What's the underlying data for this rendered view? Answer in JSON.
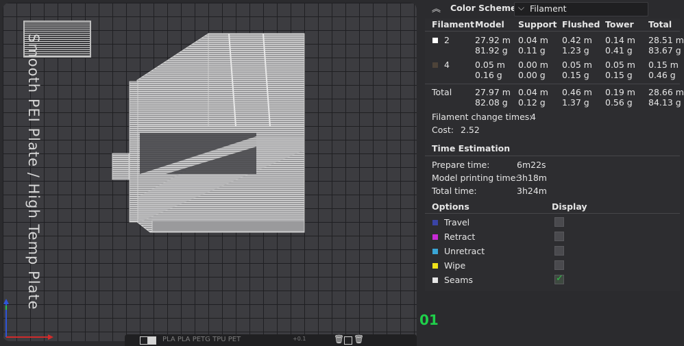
{
  "plate": {
    "label": "Smooth PEI Plate / High Temp Plate",
    "number": "01",
    "bottom_bar_text": "PLA  PLA  PETG  TPU  PET",
    "bottom_bar_small": "+0.1"
  },
  "panel": {
    "color_scheme_title": "Color Scheme",
    "color_scheme_value": "Filament",
    "table_headers": [
      "Filament",
      "Model",
      "Support",
      "Flushed",
      "Tower",
      "Total"
    ],
    "rows": [
      {
        "filament": "2",
        "swatch": "#ffffff",
        "model": [
          "27.92 m",
          "81.92 g"
        ],
        "support": [
          "0.04 m",
          "0.11 g"
        ],
        "flushed": [
          "0.42 m",
          "1.23 g"
        ],
        "tower": [
          "0.14 m",
          "0.41 g"
        ],
        "total": [
          "28.51 m",
          "83.67 g"
        ]
      },
      {
        "filament": "4",
        "swatch": "#4d4339",
        "model": [
          "0.05 m",
          "0.16 g"
        ],
        "support": [
          "0.00 m",
          "0.00 g"
        ],
        "flushed": [
          "0.05 m",
          "0.15 g"
        ],
        "tower": [
          "0.05 m",
          "0.15 g"
        ],
        "total": [
          "0.15 m",
          "0.46 g"
        ]
      }
    ],
    "total_row": {
      "label": "Total",
      "model": [
        "27.97 m",
        "82.08 g"
      ],
      "support": [
        "0.04 m",
        "0.12 g"
      ],
      "flushed": [
        "0.46 m",
        "1.37 g"
      ],
      "tower": [
        "0.19 m",
        "0.56 g"
      ],
      "total": [
        "28.66 m",
        "84.13 g"
      ]
    },
    "filament_change_label": "Filament change times:",
    "filament_change_value": "4",
    "cost_label": "Cost:",
    "cost_value": "2.52",
    "time_title": "Time Estimation",
    "prepare_label": "Prepare time:",
    "prepare_value": "6m22s",
    "model_print_label": "Model printing time:",
    "model_print_value": "3h18m",
    "total_time_label": "Total time:",
    "total_time_value": "3h24m",
    "options_title": "Options",
    "display_title": "Display",
    "options": [
      {
        "label": "Travel",
        "color": "#3a44a6",
        "checked": false
      },
      {
        "label": "Retract",
        "color": "#c82ad6",
        "checked": false
      },
      {
        "label": "Unretract",
        "color": "#3aa6d6",
        "checked": false
      },
      {
        "label": "Wipe",
        "color": "#f0e21a",
        "checked": false
      },
      {
        "label": "Seams",
        "color": "#e6e6e6",
        "checked": true
      }
    ]
  },
  "icons": [
    "collapse-up-icon",
    "chevron-down-icon",
    "checkmark-icon",
    "trash-icon",
    "axis-gizmo-icon"
  ]
}
